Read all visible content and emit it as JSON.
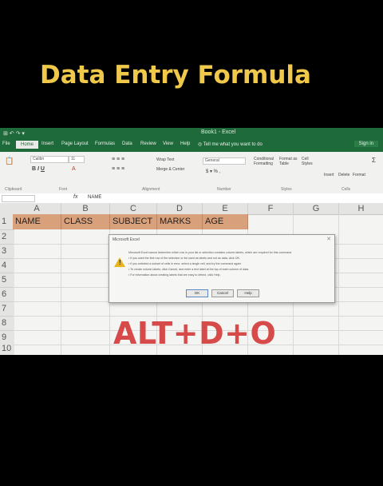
{
  "headline": "Data Entry Formula",
  "shortcut": "ALT+D+O",
  "excel": {
    "title": "Book1 - Excel",
    "quick_access": "⊞ ↶ ↷ ▾",
    "tabs": [
      "File",
      "Home",
      "Insert",
      "Page Layout",
      "Formulas",
      "Data",
      "Review",
      "View",
      "Help"
    ],
    "tell_me": "Tell me what you want to do",
    "sign_in": "Sign in",
    "ribbon": {
      "groups": [
        "Clipboard",
        "Font",
        "Alignment",
        "Number",
        "Styles",
        "Cells"
      ],
      "font_name": "Calibri",
      "font_size": "11",
      "wrap_text": "Wrap Text",
      "merge_center": "Merge & Center",
      "number_format": "General",
      "currency": "$ ▾ % ,",
      "conditional_formatting": "Conditional Formatting",
      "format_as_table": "Format as Table",
      "cell_styles": "Cell Styles",
      "insert": "Insert",
      "delete": "Delete",
      "format": "Format"
    },
    "formula_bar": {
      "fx": "fx",
      "value": "NAME"
    },
    "columns": [
      "A",
      "B",
      "C",
      "D",
      "E",
      "F",
      "G",
      "H"
    ],
    "rows": [
      "1",
      "2",
      "3",
      "4",
      "5",
      "6",
      "7",
      "8",
      "9",
      "10"
    ],
    "header_cells": [
      "NAME",
      "CLASS",
      "SUBJECT",
      "MARKS",
      "AGE"
    ],
    "dialog": {
      "title": "Microsoft Excel",
      "close": "✕",
      "message": [
        "Microsoft Excel cannot determine which row in your list or selection contains column labels, which are required for this command.",
        "• If you want the first row of the selection or list used as labels and not as data, click OK.",
        "• If you selected a subset of cells in error, select a single cell, and try the command again.",
        "• To create column labels, click Cancel, and enter a text label at the top of each column of data.",
        "• For information about creating labels that are easy to detect, click Help."
      ],
      "buttons": [
        "OK",
        "Cancel",
        "Help"
      ]
    }
  }
}
